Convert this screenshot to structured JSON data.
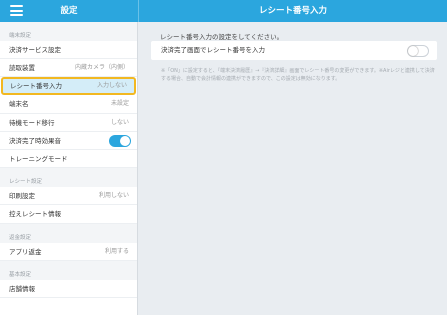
{
  "header": {
    "left_title": "設定",
    "right_title": "レシート番号入力"
  },
  "sidebar": {
    "sections": [
      {
        "header": "端末設定",
        "items": [
          {
            "label": "決済サービス設定",
            "value": ""
          },
          {
            "label": "読取装置",
            "value": "内蔵カメラ（内側）"
          },
          {
            "label": "レシート番号入力",
            "value": "入力しない",
            "selected": true
          },
          {
            "label": "端末名",
            "value": "未設定"
          },
          {
            "label": "待機モード移行",
            "value": "しない"
          },
          {
            "label": "決済完了時効果音",
            "value": "",
            "toggle": "on"
          },
          {
            "label": "トレーニングモード",
            "value": ""
          }
        ]
      },
      {
        "header": "レシート設定",
        "items": [
          {
            "label": "印刷設定",
            "value": "利用しない"
          },
          {
            "label": "控えレシート情報",
            "value": ""
          }
        ]
      },
      {
        "header": "返金設定",
        "items": [
          {
            "label": "アプリ返金",
            "value": "利用する"
          }
        ]
      },
      {
        "header": "基本設定",
        "items": [
          {
            "label": "店舗情報",
            "value": ""
          }
        ]
      }
    ]
  },
  "main": {
    "instruction": "レシート番号入力の設定をしてください。",
    "setting_label": "決済完了画面でレシート番号を入力",
    "setting_toggle": "off",
    "note": "※「ON」に設定すると、『端末決済履歴』→『決済詳細』画面でレシート番号の変更ができます。※Airレジと連携して決済する場合、自動で会計情報の連携ができますので、この設定は無効になります。"
  },
  "colors": {
    "accent": "#2ba6de",
    "highlight_border": "#f2b821",
    "selected_bg": "#d4edf8"
  }
}
